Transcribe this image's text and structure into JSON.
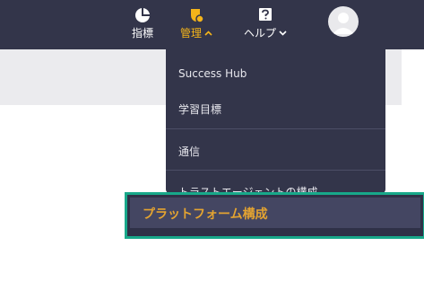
{
  "header": {
    "nav": [
      {
        "label": "指標",
        "icon": "pie-chart-icon"
      },
      {
        "label": "管理",
        "icon": "admin-badge-icon",
        "chevron": "up"
      },
      {
        "label": "ヘルプ",
        "icon": "help-icon",
        "chevron": "down"
      }
    ],
    "avatar_icon": "user-avatar-icon"
  },
  "dropdown": {
    "items": [
      {
        "label": "Success Hub"
      },
      {
        "label": "学習目標"
      },
      {
        "label": "通信"
      },
      {
        "label": "トラストエージェントの構成"
      }
    ]
  },
  "highlighted_item": {
    "label": "プラットフォーム構成"
  },
  "colors": {
    "topbar": "#33354a",
    "accent": "#f4b41a",
    "highlight_border": "#18a88a",
    "highlight_text": "#e3a331"
  }
}
